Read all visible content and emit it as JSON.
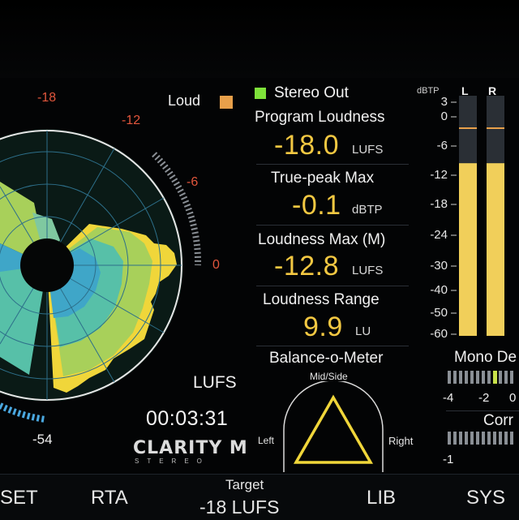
{
  "radar": {
    "scale": [
      "-18",
      "-12",
      "-6",
      "0",
      "-54"
    ],
    "legend_loud": "Loud",
    "lufs_label": "LUFS",
    "timer": "00:03:31",
    "brand": "CLARITY M",
    "brand_sub": "STEREO",
    "colors": {
      "loud": "#e8a04a",
      "ring_fill": "#33aaa8",
      "outer": "#f0d63a"
    }
  },
  "panel": {
    "source_label": "Stereo Out",
    "source_color": "#7ee23a",
    "program_loudness": {
      "label": "Program Loudness",
      "value": "-18.0",
      "unit": "LUFS"
    },
    "true_peak": {
      "label": "True-peak Max",
      "value": "-0.1",
      "unit": "dBTP"
    },
    "loudness_max": {
      "label": "Loudness Max (M)",
      "value": "-12.8",
      "unit": "LUFS"
    },
    "loudness_range": {
      "label": "Loudness Range",
      "value": "9.9",
      "unit": "LU"
    },
    "balance": {
      "title": "Balance-o-Meter",
      "mid_side": "Mid/Side",
      "left": "Left",
      "right": "Right"
    }
  },
  "meter": {
    "unit": "dBTP",
    "ch_left": "L",
    "ch_right": "R",
    "scale": [
      "3",
      "0",
      "-6",
      "-12",
      "-18",
      "-24",
      "-30",
      "-40",
      "-50",
      "-60"
    ],
    "level_left_db": -6.2,
    "level_right_db": -6.2,
    "bar_color": "#f1cf5a"
  },
  "mono": {
    "label": "Mono De",
    "scale": [
      "-4",
      "-2",
      "0"
    ]
  },
  "corr": {
    "label": "Corr",
    "scale": [
      "-1"
    ]
  },
  "bottom": {
    "preset": "SET",
    "rta": "RTA",
    "target_label": "Target",
    "target_value": "-18 LUFS",
    "lib": "LIB",
    "sys": "SYS"
  }
}
